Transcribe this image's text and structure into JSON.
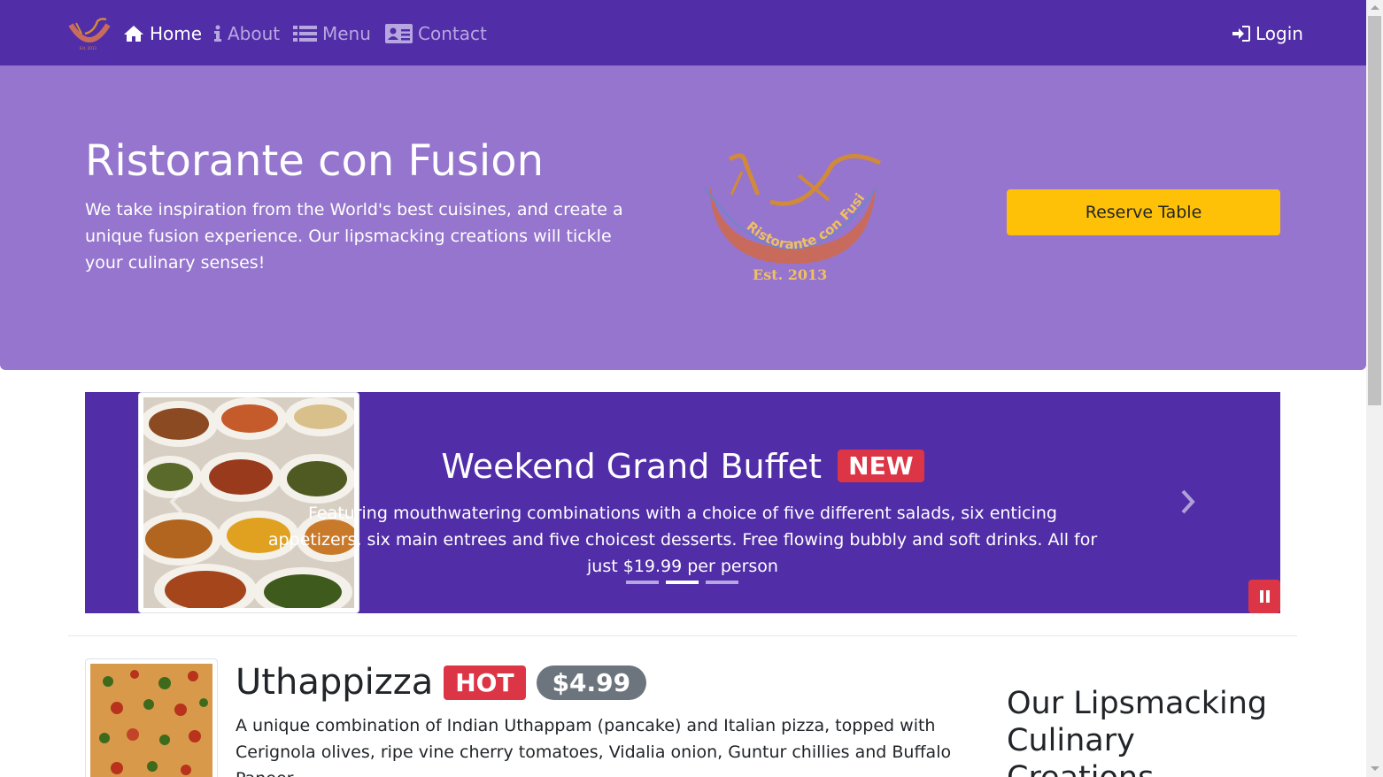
{
  "navbar": {
    "items": [
      {
        "label": "Home",
        "icon": "home-icon",
        "active": true
      },
      {
        "label": "About",
        "icon": "info-icon",
        "active": false
      },
      {
        "label": "Menu",
        "icon": "list-icon",
        "active": false
      },
      {
        "label": "Contact",
        "icon": "address-card-icon",
        "active": false
      }
    ],
    "login_label": "Login",
    "logo_text": "Est. 2013"
  },
  "hero": {
    "title": "Ristorante con Fusion",
    "text": "We take inspiration from the World's best cuisines, and create a unique fusion experience. Our lipsmacking creations will tickle your culinary senses!",
    "logo_arc_text": "Ristorante con Fusion",
    "logo_est_text": "Est. 2013",
    "reserve_label": "Reserve Table"
  },
  "carousel": {
    "title": "Weekend Grand Buffet",
    "badge": "NEW",
    "text": "Featuring mouthwatering combinations with a choice of five different salads, six enticing appetizers, six main entrees and five choicest desserts. Free flowing bubbly and soft drinks. All for just $19.99 per person",
    "slide_count": 3,
    "active_slide": 1
  },
  "featured": {
    "name": "Uthappizza",
    "badge": "HOT",
    "price": "$4.99",
    "description": "A unique combination of Indian Uthappam (pancake) and Italian pizza, topped with Cerignola olives, ripe vine cherry tomatoes, Vidalia onion, Guntur chillies and Buffalo Paneer."
  },
  "side": {
    "heading": "Our Lipsmacking Culinary Creations"
  },
  "colors": {
    "primary_dark": "#512DA8",
    "primary_light": "#9575CD",
    "warning": "#FFC107",
    "danger": "#dc3545",
    "secondary": "#6c757d"
  }
}
